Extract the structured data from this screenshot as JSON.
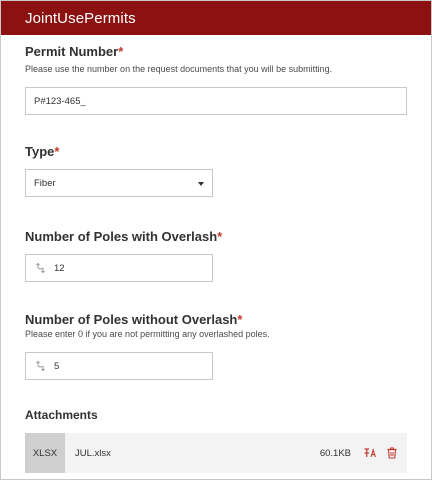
{
  "header": {
    "title": "JointUsePermits"
  },
  "permit_number": {
    "label": "Permit Number",
    "required_mark": "*",
    "help": "Please use the number on the request documents that you will be submitting.",
    "value": "P#123-465_"
  },
  "type": {
    "label": "Type",
    "required_mark": "*",
    "selected": "Fiber"
  },
  "poles_with_overlash": {
    "label": "Number of Poles with Overlash",
    "required_mark": "*",
    "value": "12"
  },
  "poles_without_overlash": {
    "label": "Number of Poles without Overlash",
    "required_mark": "*",
    "help": "Please enter 0 if you are not permitting any overlashed poles.",
    "value": "5"
  },
  "attachments": {
    "label": "Attachments",
    "items": [
      {
        "type": "XLSX",
        "name": "JUL.xlsx",
        "size": "60.1KB"
      }
    ]
  },
  "colors": {
    "header_bg": "#8c1212",
    "required": "#c0392b",
    "action_icon": "#c0392b"
  }
}
